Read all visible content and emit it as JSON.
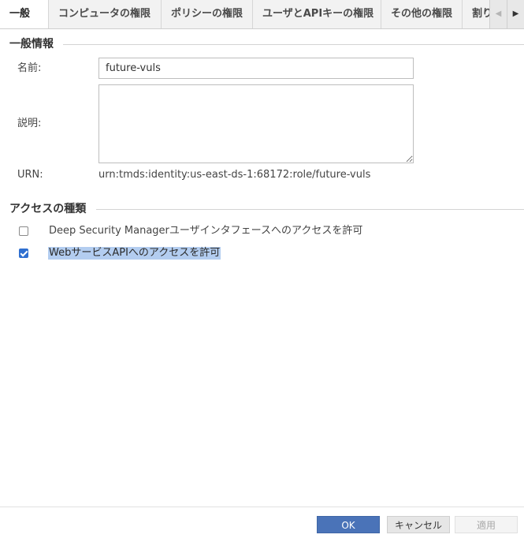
{
  "tabs": [
    {
      "label": "一般",
      "active": true
    },
    {
      "label": "コンピュータの権限"
    },
    {
      "label": "ポリシーの権限"
    },
    {
      "label": "ユーザとAPIキーの権限"
    },
    {
      "label": "その他の権限"
    },
    {
      "label": "割り"
    }
  ],
  "tab_nav": {
    "prev": "◀",
    "next": "▶"
  },
  "general": {
    "title": "一般情報",
    "name_label": "名前:",
    "name_value": "future-vuls",
    "description_label": "説明:",
    "description_value": "",
    "urn_label": "URN:",
    "urn_value": "urn:tmds:identity:us-east-ds-1:68172:role/future-vuls"
  },
  "access": {
    "title": "アクセスの種類",
    "options": [
      {
        "label": "Deep Security Managerユーザインタフェースへのアクセスを許可",
        "checked": false
      },
      {
        "label": "WebサービスAPIへのアクセスを許可",
        "checked": true
      }
    ]
  },
  "footer": {
    "ok_label": "OK",
    "cancel_label": "キャンセル",
    "apply_label": "適用"
  },
  "colors": {
    "accent": "#4a73b8",
    "checkbox_checked": "#2f6fd0",
    "selection": "#b3cdf0"
  }
}
